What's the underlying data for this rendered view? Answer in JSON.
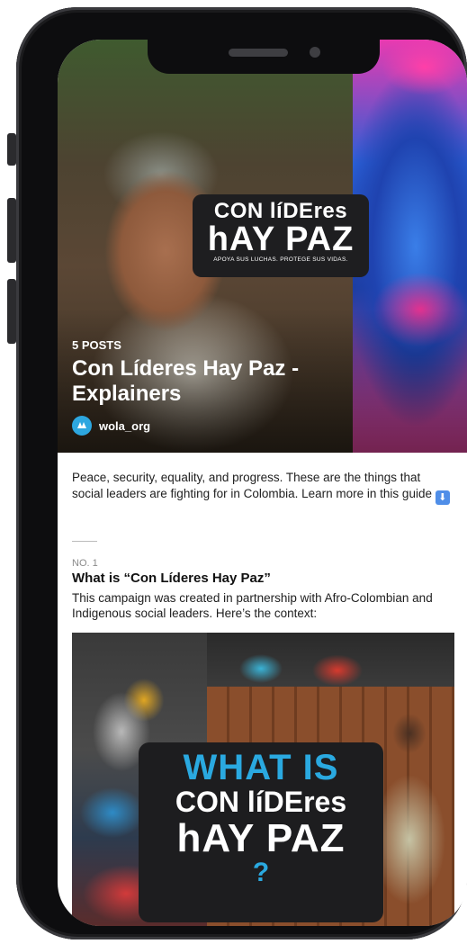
{
  "hero": {
    "logo_line1": "CON líDEres",
    "logo_line2": "hAY PAZ",
    "logo_tagline": "APOYA SUS LUCHAS. PROTEGE SUS VIDAS.",
    "posts_count": "5 POSTS",
    "title": "Con Líderes Hay Paz - Explainers",
    "author": "wola_org",
    "avatar_icon": "wola-logo-icon"
  },
  "intro": {
    "text": "Peace, security, equality, and progress. These are the things that social leaders are fighting for in Colombia. Learn more in this guide",
    "arrow_icon": "⬇",
    "arrow_color": "#4f8ee8"
  },
  "post": {
    "number": "NO. 1",
    "title": "What is “Con Líderes Hay Paz”",
    "description": "This campaign was created in partnership with Afro-Colombian and Indigenous social leaders. Here’s the context:",
    "image_text": {
      "line1": "WHAT IS",
      "line2": "CON líDEres",
      "line3": "hAY PAZ",
      "line4": "?"
    }
  },
  "colors": {
    "accent_blue": "#2aa9e0",
    "frame": "#0d0d0f"
  }
}
